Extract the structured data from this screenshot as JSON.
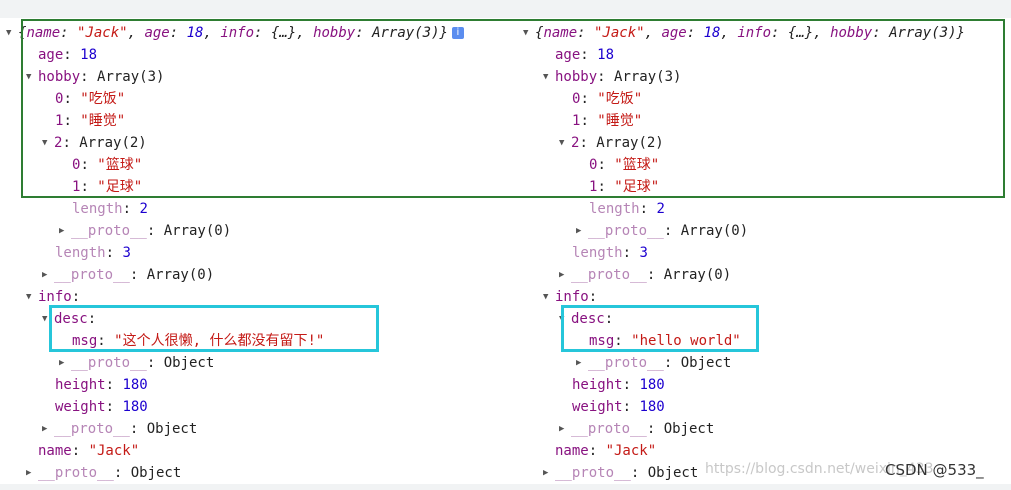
{
  "left_panel": {
    "summary_open": "{",
    "summary_k1": "name",
    "summary_v1": "\"Jack\"",
    "summary_k2": "age",
    "summary_v2": "18",
    "summary_k3": "info",
    "summary_v3": "{…}",
    "summary_k4": "hobby",
    "summary_v4": "Array(3)}",
    "age_key": "age",
    "age_val": "18",
    "hobby_key": "hobby",
    "hobby_type": "Array(3)",
    "h0_key": "0",
    "h0_val": "\"吃饭\"",
    "h1_key": "1",
    "h1_val": "\"睡觉\"",
    "h2_key": "2",
    "h2_type": "Array(2)",
    "h20_key": "0",
    "h20_val": "\"篮球\"",
    "h21_key": "1",
    "h21_val": "\"足球\"",
    "inner_length_key": "length",
    "inner_length_val": "2",
    "inner_proto_key": "__proto__",
    "inner_proto_val": "Array(0)",
    "hobby_length_key": "length",
    "hobby_length_val": "3",
    "hobby_proto_key": "__proto__",
    "hobby_proto_val": "Array(0)",
    "info_key": "info",
    "desc_key": "desc",
    "msg_key": "msg",
    "msg_val": "\"这个人很懒, 什么都没有留下!\"",
    "desc_proto_key": "__proto__",
    "desc_proto_val": "Object",
    "height_key": "height",
    "height_val": "180",
    "weight_key": "weight",
    "weight_val": "180",
    "info_proto_key": "__proto__",
    "info_proto_val": "Object",
    "name_key": "name",
    "name_val": "\"Jack\"",
    "root_proto_key": "__proto__",
    "root_proto_val": "Object"
  },
  "right_panel": {
    "summary_open": "{",
    "summary_k1": "name",
    "summary_v1": "\"Jack\"",
    "summary_k2": "age",
    "summary_v2": "18",
    "summary_k3": "info",
    "summary_v3": "{…}",
    "summary_k4": "hobby",
    "summary_v4": "Array(3)}",
    "age_key": "age",
    "age_val": "18",
    "hobby_key": "hobby",
    "hobby_type": "Array(3)",
    "h0_key": "0",
    "h0_val": "\"吃饭\"",
    "h1_key": "1",
    "h1_val": "\"睡觉\"",
    "h2_key": "2",
    "h2_type": "Array(2)",
    "h20_key": "0",
    "h20_val": "\"篮球\"",
    "h21_key": "1",
    "h21_val": "\"足球\"",
    "inner_length_key": "length",
    "inner_length_val": "2",
    "inner_proto_key": "__proto__",
    "inner_proto_val": "Array(0)",
    "hobby_length_key": "length",
    "hobby_length_val": "3",
    "hobby_proto_key": "__proto__",
    "hobby_proto_val": "Array(0)",
    "info_key": "info",
    "desc_key": "desc",
    "msg_key": "msg",
    "msg_val": "\"hello world\"",
    "desc_proto_key": "__proto__",
    "desc_proto_val": "Object",
    "height_key": "height",
    "height_val": "180",
    "weight_key": "weight",
    "weight_val": "180",
    "info_proto_key": "__proto__",
    "info_proto_val": "Object",
    "name_key": "name",
    "name_val": "\"Jack\"",
    "root_proto_key": "__proto__",
    "root_proto_val": "Object"
  },
  "info_badge": "i",
  "watermark": "https://blog.csdn.net/weixin_433",
  "csdn_tag": "CSDN @533_",
  "colors": {
    "highlight_green": "#2e7d32",
    "highlight_cyan": "#26c6da",
    "key": "#881280",
    "string": "#c41a16",
    "number": "#1c00cf"
  }
}
